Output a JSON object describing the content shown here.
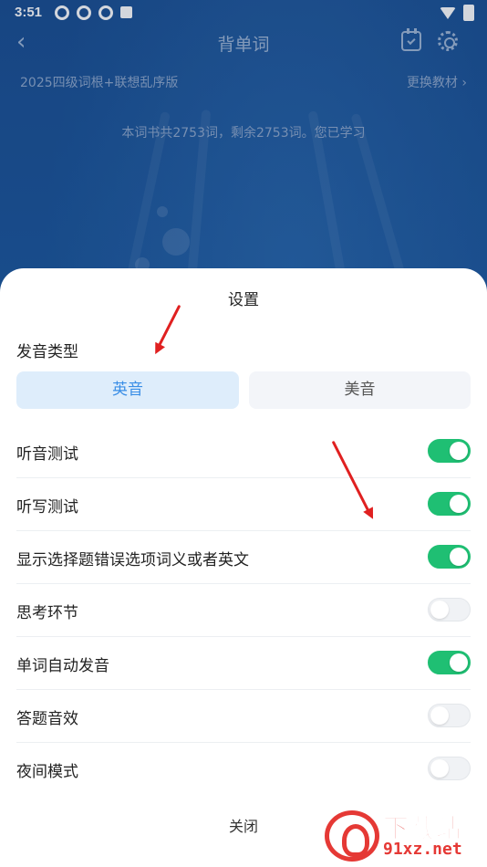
{
  "status_bar": {
    "time": "3:51"
  },
  "header": {
    "title": "背单词",
    "book_name": "2025四级词根+联想乱序版",
    "change_book": "更换教材",
    "summary": "本词书共2753词，剩余2753词。您已学习"
  },
  "sheet": {
    "title": "设置",
    "pronunciation_label": "发音类型",
    "pronunciation_options": [
      {
        "label": "英音",
        "selected": true
      },
      {
        "label": "美音",
        "selected": false
      }
    ],
    "settings": [
      {
        "label": "听音测试",
        "enabled": true
      },
      {
        "label": "听写测试",
        "enabled": true
      },
      {
        "label": "显示选择题错误选项词义或者英文",
        "enabled": true
      },
      {
        "label": "思考环节",
        "enabled": false
      },
      {
        "label": "单词自动发音",
        "enabled": true
      },
      {
        "label": "答题音效",
        "enabled": false
      },
      {
        "label": "夜间模式",
        "enabled": false
      }
    ],
    "close_label": "关闭"
  },
  "watermark": {
    "brand": "下载站",
    "url": "91xz.net"
  },
  "colors": {
    "accent": "#3a8ee6",
    "toggle_on": "#1fbf73",
    "annotation": "#e02020"
  }
}
